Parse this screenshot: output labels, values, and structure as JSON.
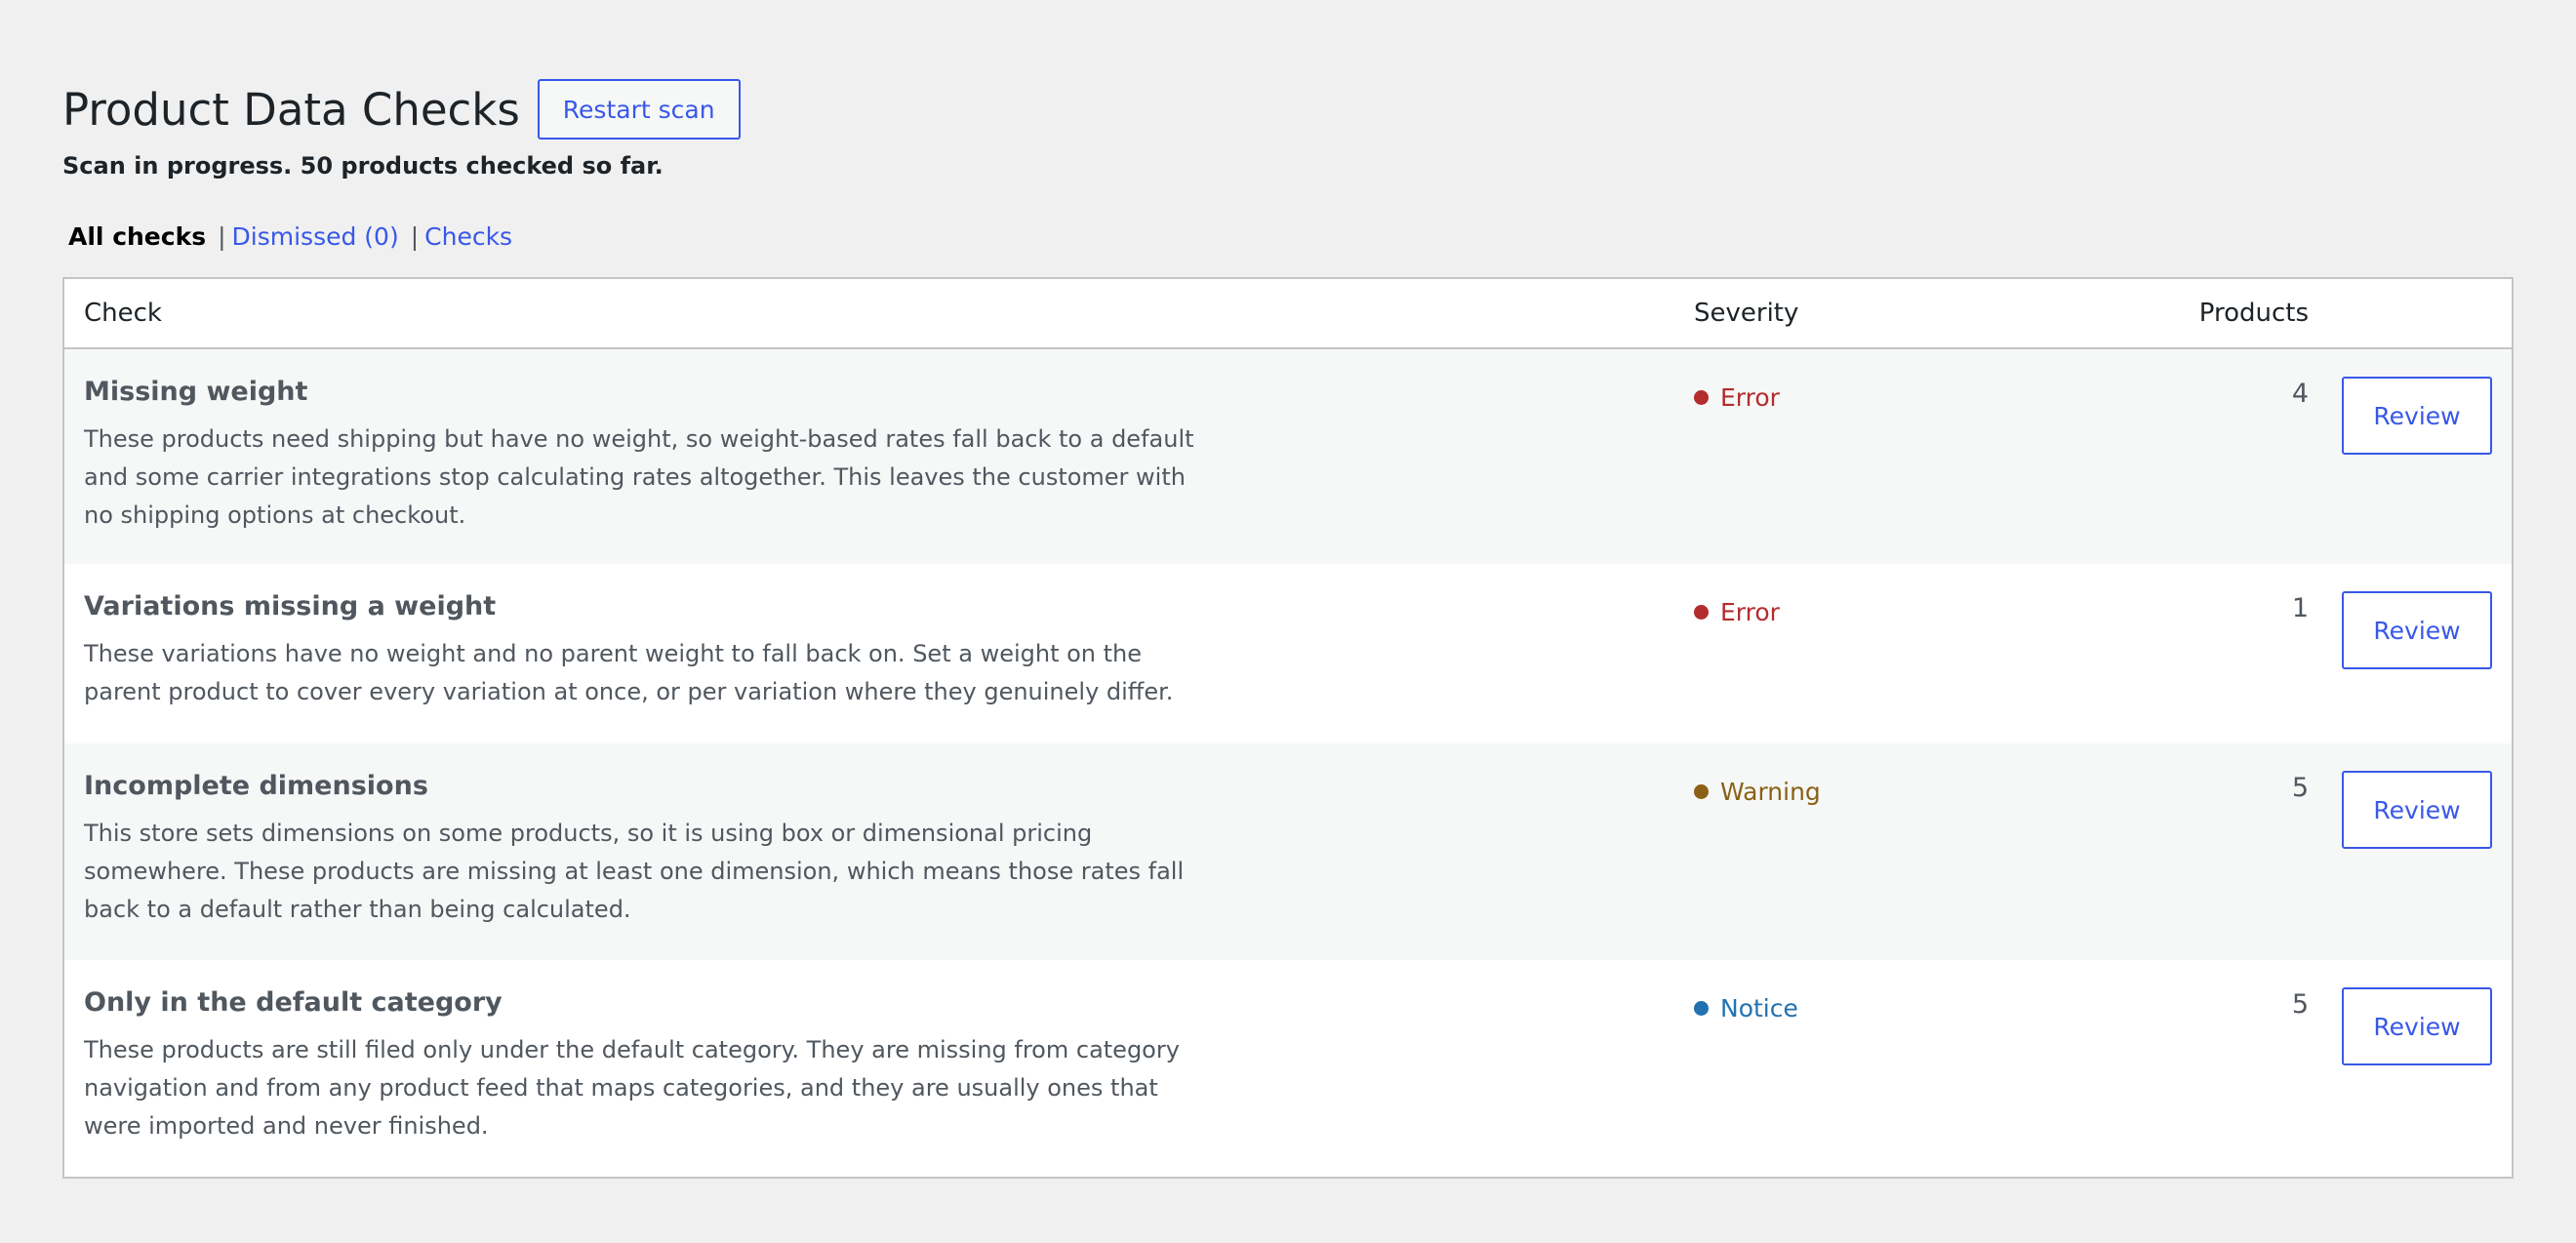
{
  "header": {
    "title": "Product Data Checks",
    "restart_label": "Restart scan",
    "status": "Scan in progress. 50 products checked so far."
  },
  "filters": {
    "all": "All checks",
    "dismissed": "Dismissed (0)",
    "checks": "Checks",
    "separator": "|"
  },
  "table": {
    "headers": {
      "check": "Check",
      "severity": "Severity",
      "products": "Products"
    },
    "rows": [
      {
        "name": "Missing weight",
        "description": "These products need shipping but have no weight, so weight-based rates fall back to a default and some carrier integrations stop calculating rates altogether. This leaves the customer with no shipping options at checkout.",
        "severity": "Error",
        "severity_color": "#b32d2e",
        "products": "4",
        "action": "Review"
      },
      {
        "name": "Variations missing a weight",
        "description": "These variations have no weight and no parent weight to fall back on. Set a weight on the parent product to cover every variation at once, or per variation where they genuinely differ.",
        "severity": "Error",
        "severity_color": "#b32d2e",
        "products": "1",
        "action": "Review"
      },
      {
        "name": "Incomplete dimensions",
        "description": "This store sets dimensions on some products, so it is using box or dimensional pricing somewhere. These products are missing at least one dimension, which means those rates fall back to a default rather than being calculated.",
        "severity": "Warning",
        "severity_color": "#8a6116",
        "products": "5",
        "action": "Review"
      },
      {
        "name": "Only in the default category",
        "description": "These products are still filed only under the default category. They are missing from category navigation and from any product feed that maps categories, and they are usually ones that were imported and never finished.",
        "severity": "Notice",
        "severity_color": "#2271b1",
        "products": "5",
        "action": "Review"
      }
    ]
  }
}
